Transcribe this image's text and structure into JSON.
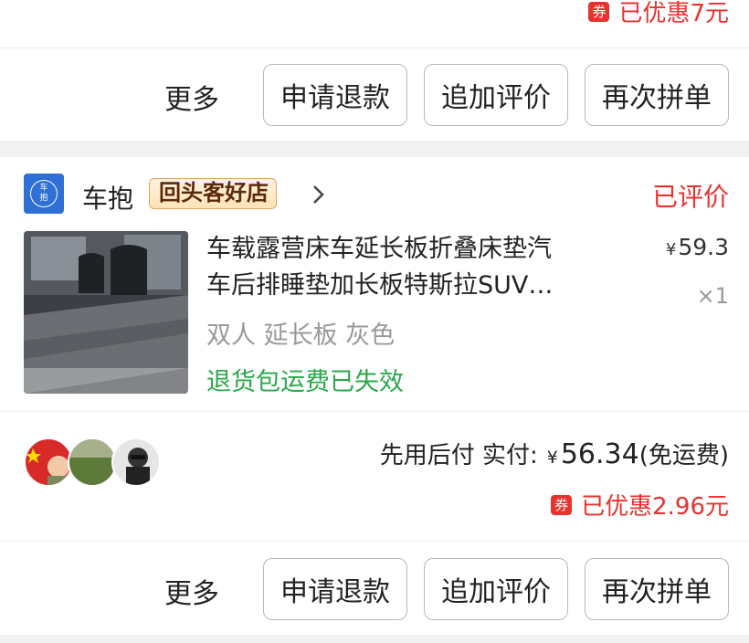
{
  "order_prev": {
    "discount": {
      "coupon_label": "券",
      "text": "已优惠7元"
    },
    "actions": {
      "more": "更多",
      "refund": "申请退款",
      "review": "追加评价",
      "reorder": "再次拼单"
    }
  },
  "order": {
    "store": {
      "logo_text_1": "车",
      "logo_text_2": "抱",
      "name": "车抱",
      "badge": "回头客好店",
      "status": "已评价"
    },
    "product": {
      "title_line1": "车载露营床车延长板折叠床垫汽",
      "title_line2": "车后排睡垫加长板特斯拉SUV…",
      "price_symbol": "¥",
      "price": "59.3",
      "quantity": "×1",
      "spec": "双人 延长板 灰色",
      "return_policy": "退货包运费已失效"
    },
    "summary": {
      "pay_label": "先用后付 实付:",
      "currency": "¥",
      "amount": "56.34",
      "shipping": "(免运费)"
    },
    "discount": {
      "coupon_label": "券",
      "text": "已优惠2.96元"
    },
    "actions": {
      "more": "更多",
      "refund": "申请退款",
      "review": "追加评价",
      "reorder": "再次拼单"
    }
  },
  "colors": {
    "accent_red": "#e8322e",
    "green": "#2aa84a",
    "store_blue": "#2f6fd6"
  }
}
